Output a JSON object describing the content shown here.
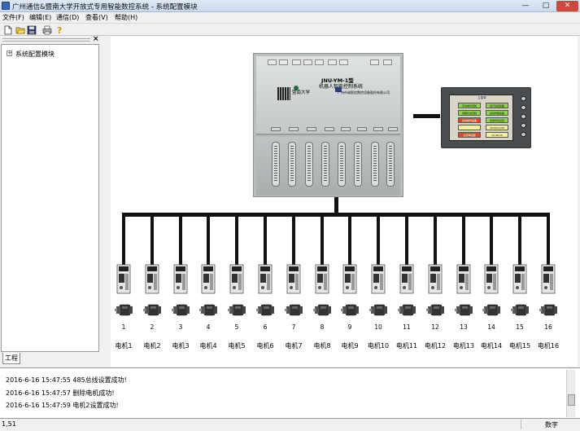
{
  "window": {
    "title": "广州通信&暨南大学开放式专用智能数控系统 - 系统配置模块",
    "minimize_glyph": "—",
    "maximize_glyph": "□",
    "close_glyph": "✕"
  },
  "menu": [
    {
      "label": "文件(F)"
    },
    {
      "label": "编辑(E)"
    },
    {
      "label": "通信(D)"
    },
    {
      "label": "查看(V)"
    },
    {
      "label": "帮助(H)"
    }
  ],
  "toolbar": [
    {
      "icon": "new-file-icon"
    },
    {
      "icon": "open-folder-icon"
    },
    {
      "icon": "save-icon"
    },
    {
      "icon": "print-icon"
    },
    {
      "icon": "help-icon"
    }
  ],
  "left_pane": {
    "close_glyph": "×",
    "expander": "+",
    "tree_root": "系统配置模块",
    "tab_label": "工程"
  },
  "controller": {
    "model": "JNU-YM-1型",
    "description": "机器人智能控制系统",
    "university": "暨南大学",
    "company": "广州市诚智信数控设备股份有限公司"
  },
  "hmi": {
    "title": "主菜单",
    "buttons": [
      {
        "label": "手动单步控制",
        "color": "green"
      },
      {
        "label": "运行监控画面",
        "color": "green"
      },
      {
        "label": "伺服状态控制",
        "color": "green"
      },
      {
        "label": "运动参数画面",
        "color": "green"
      },
      {
        "label": "基本操作画面",
        "color": "red"
      },
      {
        "label": "系统时间设置",
        "color": "green"
      },
      {
        "label": "",
        "color": "yellow"
      },
      {
        "label": "2016/12/28",
        "color": "yellow"
      },
      {
        "label": "主菜单画面",
        "color": "red"
      },
      {
        "label": "12:46:25",
        "color": "yellow"
      }
    ]
  },
  "axes": [
    {
      "num": "1",
      "label": "电机1"
    },
    {
      "num": "2",
      "label": "电机2"
    },
    {
      "num": "3",
      "label": "电机3"
    },
    {
      "num": "4",
      "label": "电机4"
    },
    {
      "num": "5",
      "label": "电机5"
    },
    {
      "num": "6",
      "label": "电机6"
    },
    {
      "num": "7",
      "label": "电机7"
    },
    {
      "num": "8",
      "label": "电机8"
    },
    {
      "num": "9",
      "label": "电机9"
    },
    {
      "num": "10",
      "label": "电机10"
    },
    {
      "num": "11",
      "label": "电机11"
    },
    {
      "num": "12",
      "label": "电机12"
    },
    {
      "num": "13",
      "label": "电机13"
    },
    {
      "num": "14",
      "label": "电机14"
    },
    {
      "num": "15",
      "label": "电机15"
    },
    {
      "num": "16",
      "label": "电机16"
    }
  ],
  "log": [
    "2016-6-16 15:47:55 485总线设置成功!",
    "2016-6-16 15:47:57 删除电机成功!",
    "2016-6-16 15:47:59 电机2设置成功!"
  ],
  "status": {
    "left": "1,51",
    "right": "数字"
  },
  "colors": {
    "bus": "#111111",
    "hmi_green": "#8cd44a",
    "hmi_red": "#e2462e",
    "hmi_yellow": "#f2f09a",
    "title_gradient_top": "#dfe9f5"
  }
}
